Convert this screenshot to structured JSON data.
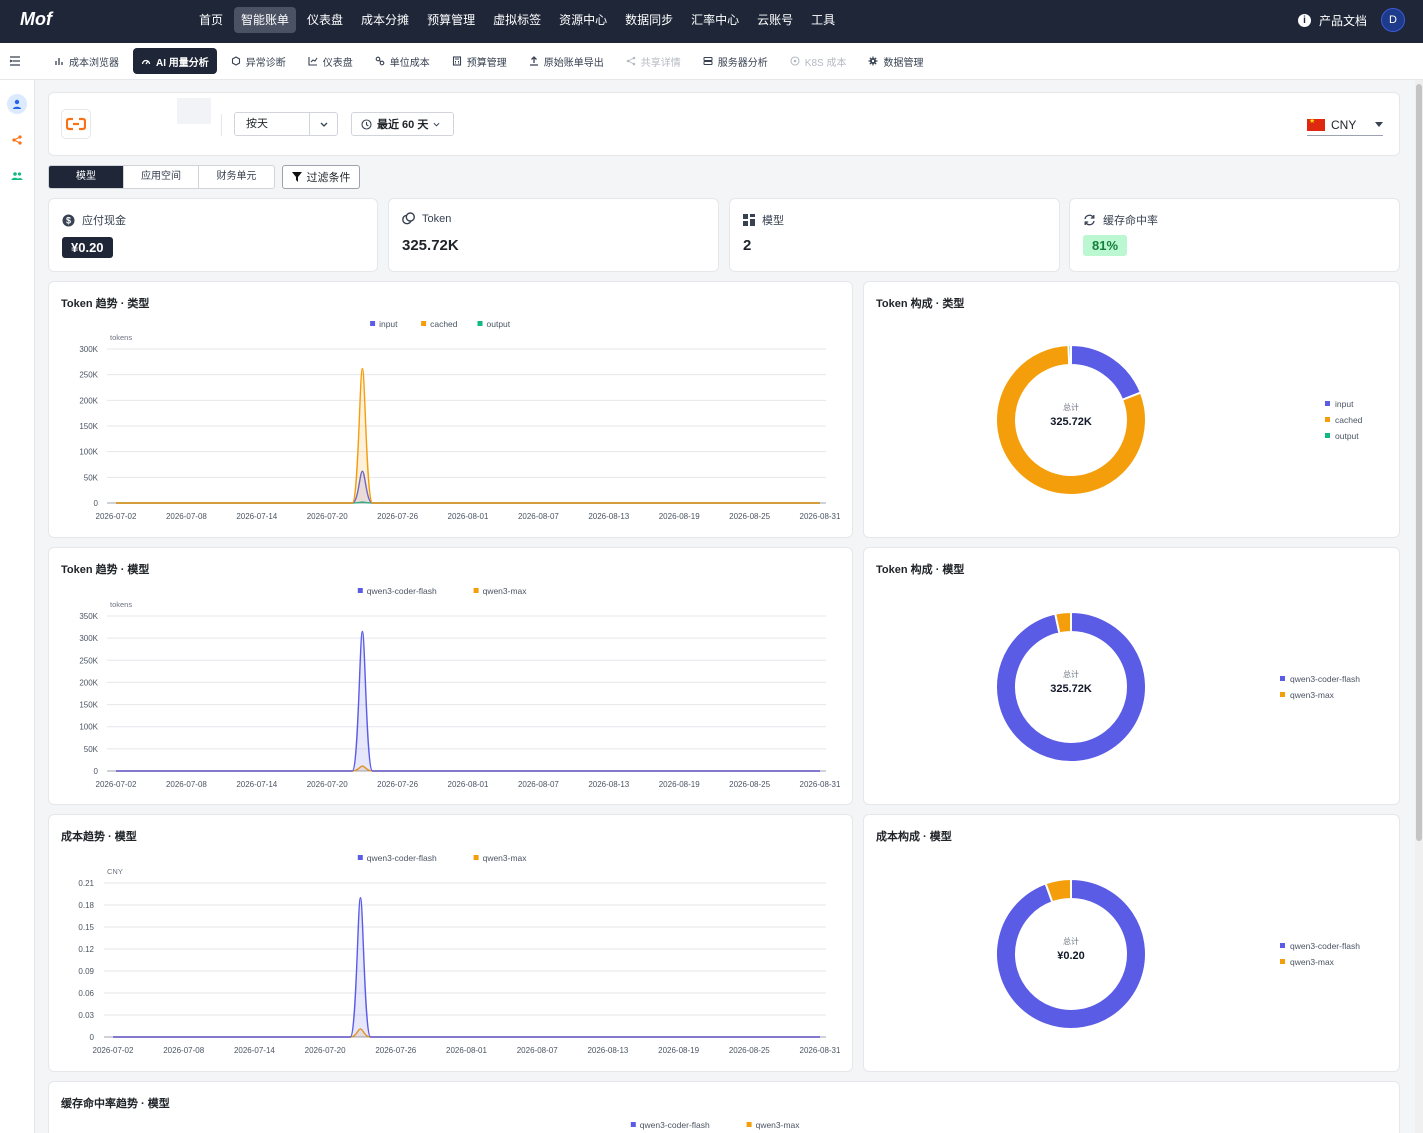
{
  "topbar": {
    "logo": "Mof",
    "nav": [
      "首页",
      "智能账单",
      "仪表盘",
      "成本分摊",
      "预算管理",
      "虚拟标签",
      "资源中心",
      "数据同步",
      "汇率中心",
      "云账号",
      "工具"
    ],
    "active_nav": 1,
    "docs_label": "产品文档",
    "avatar_initial": "D"
  },
  "subtabs": [
    {
      "label": "成本浏览器",
      "icon": "bar-chart-icon"
    },
    {
      "label": "AI 用量分析",
      "icon": "ai-gauge-icon",
      "active": true
    },
    {
      "label": "异常诊断",
      "icon": "hexagon-icon"
    },
    {
      "label": "仪表盘",
      "icon": "line-chart-icon"
    },
    {
      "label": "单位成本",
      "icon": "link-icon"
    },
    {
      "label": "预算管理",
      "icon": "calculator-icon"
    },
    {
      "label": "原始账单导出",
      "icon": "upload-icon"
    },
    {
      "label": "共享详情",
      "icon": "share-icon",
      "disabled": true
    },
    {
      "label": "服务器分析",
      "icon": "server-icon"
    },
    {
      "label": "K8S 成本",
      "icon": "k8s-icon",
      "disabled": true
    },
    {
      "label": "数据管理",
      "icon": "gear-icon"
    }
  ],
  "filters": {
    "granularity": "按天",
    "range": "最近 60 天",
    "currency": "CNY"
  },
  "group_by": {
    "options": [
      "模型",
      "应用空间",
      "财务单元"
    ],
    "active": 0
  },
  "filter_button": "过滤条件",
  "kpis": [
    {
      "label": "应付现金",
      "value": "¥0.20",
      "icon": "dollar-icon"
    },
    {
      "label": "Token",
      "value": "325.72K",
      "icon": "token-icon"
    },
    {
      "label": "模型",
      "value": "2",
      "icon": "grid-icon"
    },
    {
      "label": "缓存命中率",
      "value": "81%",
      "icon": "refresh-icon"
    }
  ],
  "colors": {
    "input": "#5b5ce6",
    "cached": "#f59e0b",
    "output": "#10b981"
  },
  "chart_data": [
    {
      "type": "area",
      "title": "Token 趋势 · 类型",
      "ylabel": "tokens",
      "ylim": [
        0,
        300000
      ],
      "yticks": [
        "0",
        "50K",
        "100K",
        "150K",
        "200K",
        "250K",
        "300K"
      ],
      "xticks": [
        "2026-07-02",
        "2026-07-08",
        "2026-07-14",
        "2026-07-20",
        "2026-07-26",
        "2026-08-01",
        "2026-08-07",
        "2026-08-13",
        "2026-08-19",
        "2026-08-25",
        "2026-08-31"
      ],
      "peak_date": "2026-07-23",
      "series": [
        {
          "name": "input",
          "peak": 62000,
          "color": "#5b5ce6"
        },
        {
          "name": "cached",
          "peak": 262000,
          "color": "#f59e0b"
        },
        {
          "name": "output",
          "peak": 1700,
          "color": "#10b981"
        }
      ]
    },
    {
      "type": "pie",
      "title": "Token 构成 · 类型",
      "center_label": "总计",
      "center_value": "325.72K",
      "slices": [
        {
          "name": "input",
          "value": 62000,
          "color": "#5b5ce6"
        },
        {
          "name": "cached",
          "value": 262000,
          "color": "#f59e0b"
        },
        {
          "name": "output",
          "value": 1700,
          "color": "#10b981"
        }
      ]
    },
    {
      "type": "area",
      "title": "Token 趋势 · 模型",
      "ylabel": "tokens",
      "ylim": [
        0,
        350000
      ],
      "yticks": [
        "0",
        "50K",
        "100K",
        "150K",
        "200K",
        "250K",
        "300K",
        "350K"
      ],
      "xticks": [
        "2026-07-02",
        "2026-07-08",
        "2026-07-14",
        "2026-07-20",
        "2026-07-26",
        "2026-08-01",
        "2026-08-07",
        "2026-08-13",
        "2026-08-19",
        "2026-08-25",
        "2026-08-31"
      ],
      "peak_date": "2026-07-23",
      "series": [
        {
          "name": "qwen3-coder-flash",
          "peak": 315000,
          "color": "#5b5ce6"
        },
        {
          "name": "qwen3-max",
          "peak": 11000,
          "color": "#f59e0b"
        }
      ]
    },
    {
      "type": "pie",
      "title": "Token 构成 · 模型",
      "center_label": "总计",
      "center_value": "325.72K",
      "slices": [
        {
          "name": "qwen3-coder-flash",
          "value": 314720,
          "color": "#5b5ce6"
        },
        {
          "name": "qwen3-max",
          "value": 11000,
          "color": "#f59e0b"
        }
      ]
    },
    {
      "type": "area",
      "title": "成本趋势 · 模型",
      "ylabel": "CNY",
      "ylim": [
        0,
        0.21
      ],
      "yticks": [
        "0",
        "0.03",
        "0.06",
        "0.09",
        "0.12",
        "0.15",
        "0.18",
        "0.21"
      ],
      "xticks": [
        "2026-07-02",
        "2026-07-08",
        "2026-07-14",
        "2026-07-20",
        "2026-07-26",
        "2026-08-01",
        "2026-08-07",
        "2026-08-13",
        "2026-08-19",
        "2026-08-25",
        "2026-08-31"
      ],
      "peak_date": "2026-07-23",
      "series": [
        {
          "name": "qwen3-coder-flash",
          "peak": 0.19,
          "color": "#5b5ce6"
        },
        {
          "name": "qwen3-max",
          "peak": 0.011,
          "color": "#f59e0b"
        }
      ]
    },
    {
      "type": "pie",
      "title": "成本构成 · 模型",
      "center_label": "总计",
      "center_value": "¥0.20",
      "slices": [
        {
          "name": "qwen3-coder-flash",
          "value": 0.189,
          "color": "#5b5ce6"
        },
        {
          "name": "qwen3-max",
          "value": 0.011,
          "color": "#f59e0b"
        }
      ]
    },
    {
      "type": "line",
      "title": "缓存命中率趋势 · 模型",
      "series": [
        {
          "name": "qwen3-coder-flash",
          "color": "#5b5ce6"
        },
        {
          "name": "qwen3-max",
          "color": "#f59e0b"
        }
      ]
    }
  ]
}
